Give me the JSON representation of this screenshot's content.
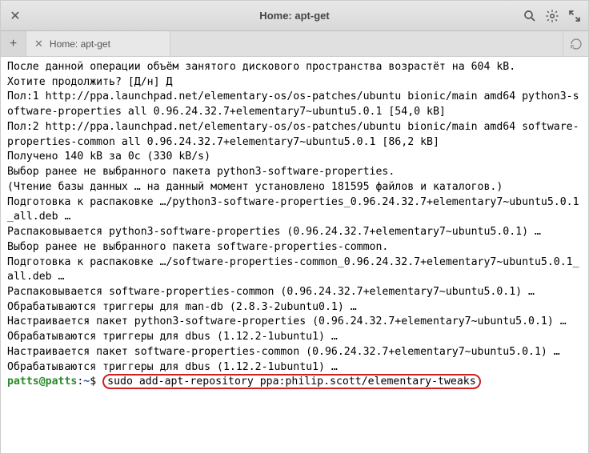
{
  "window": {
    "title": "Home: apt-get"
  },
  "tab": {
    "label": "Home: apt-get"
  },
  "terminal": {
    "lines": [
      "После данной операции объём занятого дискового пространства возрастёт на 604 kB.",
      "Хотите продолжить? [Д/н] Д",
      "Пол:1 http://ppa.launchpad.net/elementary-os/os-patches/ubuntu bionic/main amd64 python3-software-properties all 0.96.24.32.7+elementary7~ubuntu5.0.1 [54,0 kB]",
      "Пол:2 http://ppa.launchpad.net/elementary-os/os-patches/ubuntu bionic/main amd64 software-properties-common all 0.96.24.32.7+elementary7~ubuntu5.0.1 [86,2 kB]",
      "Получено 140 kB за 0с (330 kB/s)",
      "Выбор ранее не выбранного пакета python3-software-properties.",
      "(Чтение базы данных … на данный момент установлено 181595 файлов и каталогов.)",
      "Подготовка к распаковке …/python3-software-properties_0.96.24.32.7+elementary7~ubuntu5.0.1_all.deb …",
      "Распаковывается python3-software-properties (0.96.24.32.7+elementary7~ubuntu5.0.1) …",
      "Выбор ранее не выбранного пакета software-properties-common.",
      "Подготовка к распаковке …/software-properties-common_0.96.24.32.7+elementary7~ubuntu5.0.1_all.deb …",
      "Распаковывается software-properties-common (0.96.24.32.7+elementary7~ubuntu5.0.1) …",
      "Обрабатываются триггеры для man-db (2.8.3-2ubuntu0.1) …",
      "Настраивается пакет python3-software-properties (0.96.24.32.7+elementary7~ubuntu5.0.1) …",
      "Обрабатываются триггеры для dbus (1.12.2-1ubuntu1) …",
      "Настраивается пакет software-properties-common (0.96.24.32.7+elementary7~ubuntu5.0.1) …",
      "Обрабатываются триггеры для dbus (1.12.2-1ubuntu1) …"
    ],
    "prompt": {
      "user": "patts@patts",
      "path": "~",
      "symbol": "$"
    },
    "command": "sudo add-apt-repository ppa:philip.scott/elementary-tweaks"
  }
}
